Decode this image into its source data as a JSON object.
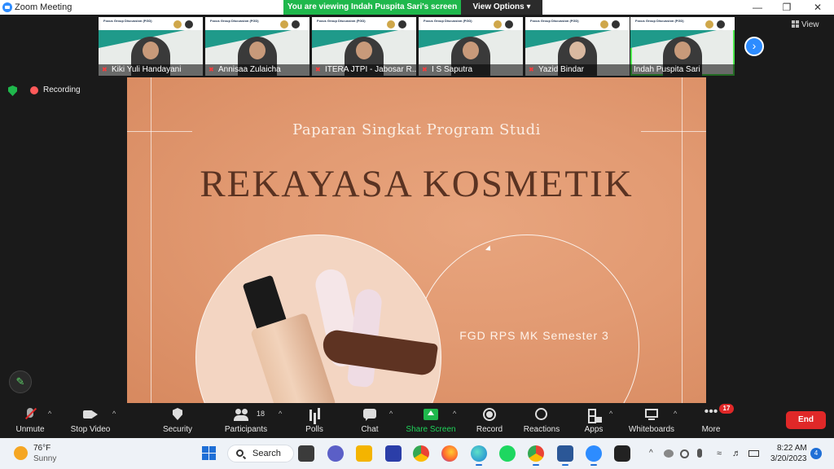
{
  "window": {
    "title": "Zoom Meeting",
    "controls": {
      "minimize": "—",
      "restore": "❐",
      "close": "✕"
    }
  },
  "share_banner": {
    "message": "You are viewing Indah Puspita Sari's screen",
    "options_label": "View Options"
  },
  "participants": [
    {
      "name": "Kiki Yuli Handayani",
      "muted": true
    },
    {
      "name": "Annisaa Zulaicha",
      "muted": true
    },
    {
      "name": "ITERA JTPI - Jabosar R...",
      "muted": true
    },
    {
      "name": "I S Saputra",
      "muted": true
    },
    {
      "name": "Yazid Bindar",
      "muted": true
    },
    {
      "name": "Indah Puspita Sari",
      "muted": false,
      "active_speaker": true
    }
  ],
  "thumb_mini_text": "Focus Group Discussion (FGD)",
  "next_page_icon": "chevron-right-icon",
  "view_label": "View",
  "status": {
    "recording_label": "Recording"
  },
  "slide": {
    "subtitle": "Paparan Singkat Program Studi",
    "headline": "REKAYASA KOSMETIK",
    "caption": "FGD RPS MK Semester 3",
    "colors": {
      "background": "#e29a72",
      "headline": "#5a3322",
      "circle_fill": "#f3d5c2"
    }
  },
  "toolbar": {
    "unmute": "Unmute",
    "stop_video": "Stop Video",
    "security": "Security",
    "participants": "Participants",
    "participants_count": "18",
    "polls": "Polls",
    "chat": "Chat",
    "share_screen": "Share Screen",
    "record": "Record",
    "reactions": "Reactions",
    "apps": "Apps",
    "whiteboards": "Whiteboards",
    "more": "More",
    "more_badge": "17",
    "end": "End"
  },
  "taskbar": {
    "weather_temp": "76°F",
    "weather_condition": "Sunny",
    "search_label": "Search",
    "time": "8:22 AM",
    "date": "3/20/2023",
    "notifications": "4"
  },
  "colors": {
    "accent": "#2d8cff",
    "share_green": "#1fb84c",
    "end_red": "#e02828",
    "active_outline": "#4ce84c"
  }
}
